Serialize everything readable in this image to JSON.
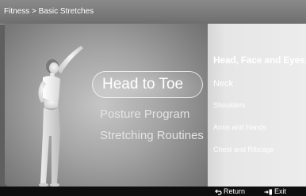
{
  "header": {
    "breadcrumb": "Fitness > Basic Stretches"
  },
  "programs": {
    "items": [
      {
        "label": "Head to Toe",
        "selected": true
      },
      {
        "label": "Posture Program",
        "selected": false
      },
      {
        "label": "Stretching Routines",
        "selected": false
      }
    ]
  },
  "submenu": {
    "items": [
      {
        "label": "Head, Face and Eyes",
        "selected": true
      },
      {
        "label": "Neck",
        "selected": false
      },
      {
        "label": "Shoulders",
        "selected": false
      },
      {
        "label": "Arms and Hands",
        "selected": false
      },
      {
        "label": "Chest and Ribcage",
        "selected": false
      }
    ]
  },
  "footer": {
    "return_label": "Return",
    "return_icon": "return-arrow-icon",
    "exit_label": "Exit",
    "exit_icon": "exit-door-icon"
  },
  "colors": {
    "header_bg": "#7a7a7a",
    "side_panel_bg": "#e6e6e6",
    "footer_bg": "#0e0e0e",
    "text": "#ffffff"
  }
}
